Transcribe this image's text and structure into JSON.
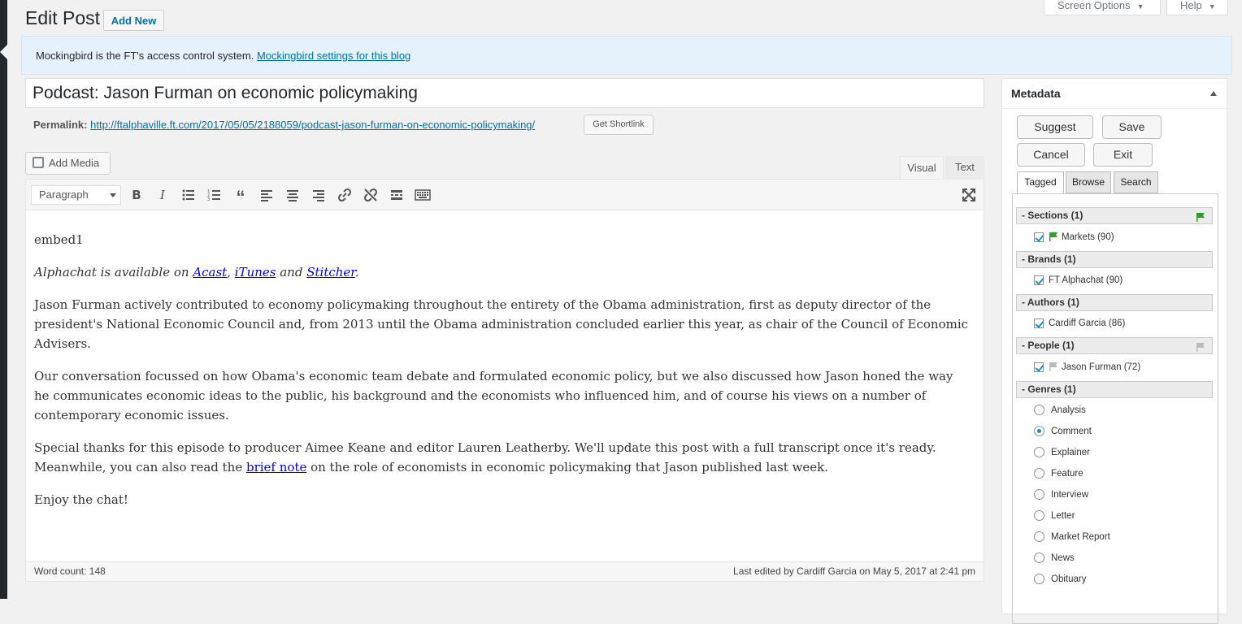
{
  "header": {
    "title": "Edit Post",
    "add_new": "Add New",
    "screen_options": "Screen Options",
    "help": "Help"
  },
  "notice": {
    "text": "Mockingbird is the FT's access control system.",
    "link": "Mockingbird settings for this blog"
  },
  "post": {
    "title": "Podcast: Jason Furman on economic policymaking",
    "permalink_label": "Permalink:",
    "permalink_url": "http://ftalphaville.ft.com/2017/05/05/2188059/podcast-jason-furman-on-economic-policymaking/",
    "shortlink_button": "Get Shortlink"
  },
  "editor": {
    "add_media": "Add Media",
    "tab_visual": "Visual",
    "tab_text": "Text",
    "format_select": "Paragraph",
    "toolbar_icons": [
      "bold-icon",
      "italic-icon",
      "bullet-list-icon",
      "numbered-list-icon",
      "blockquote-icon",
      "align-left-icon",
      "align-center-icon",
      "align-right-icon",
      "link-icon",
      "unlink-icon",
      "read-more-icon",
      "toolbar-toggle-icon",
      "fullscreen-icon"
    ],
    "content": {
      "p1": "embed1",
      "p2_prefix": "Alphachat is available on ",
      "p2_link1": "Acast",
      "p2_sep1": ", ",
      "p2_link2": "iTunes",
      "p2_sep2": " and ",
      "p2_link3": "Stitcher",
      "p2_suffix": ".",
      "p3": "Jason Furman actively contributed to economy policymaking throughout the entirety of the Obama administration, first as deputy director of the president's National Economic Council and, from 2013 until the Obama administration concluded earlier this year, as chair of the Council of Economic Advisers.",
      "p4": "Our conversation focussed on how Obama's economic team debate and formulated economic policy, but we also discussed how Jason honed the way he communicates economic ideas to the public, his background and the economists who influenced him, and of course his views on a number of contemporary economic issues.",
      "p5_prefix": "Special thanks for this episode to producer Aimee Keane and editor Lauren Leatherby. We'll update this post with a full transcript once it's ready. Meanwhile, you can also read the ",
      "p5_link": "brief note",
      "p5_suffix": " on the role of economists in economic policymaking that Jason published last week.",
      "p6": "Enjoy the chat!"
    },
    "word_count": "Word count: 148",
    "last_edited": "Last edited by Cardiff Garcia on May 5, 2017 at 2:41 pm"
  },
  "metadata": {
    "title": "Metadata",
    "buttons": {
      "suggest": "Suggest",
      "save": "Save",
      "cancel": "Cancel",
      "exit": "Exit"
    },
    "tabs": [
      "Tagged",
      "Browse",
      "Search"
    ],
    "groups": [
      {
        "label": "-  Sections (1)",
        "items": [
          "Markets (90)"
        ]
      },
      {
        "label": "-  Brands (1)",
        "items": [
          "FT Alphachat (90)"
        ]
      },
      {
        "label": "-  Authors (1)",
        "items": [
          "Cardiff Garcia (86)"
        ]
      },
      {
        "label": "-  People (1)",
        "items": [
          "Jason Furman (72)"
        ]
      },
      {
        "label": "-  Genres (1)",
        "options": [
          "Analysis",
          "Comment",
          "Explainer",
          "Feature",
          "Interview",
          "Letter",
          "Market Report",
          "News",
          "Obituary"
        ],
        "selected": "Comment"
      }
    ],
    "colors": {
      "primary_flag": "#2a9d2a",
      "inactive_flag": "#bbbbbb",
      "check": "#1e8cbe"
    }
  }
}
